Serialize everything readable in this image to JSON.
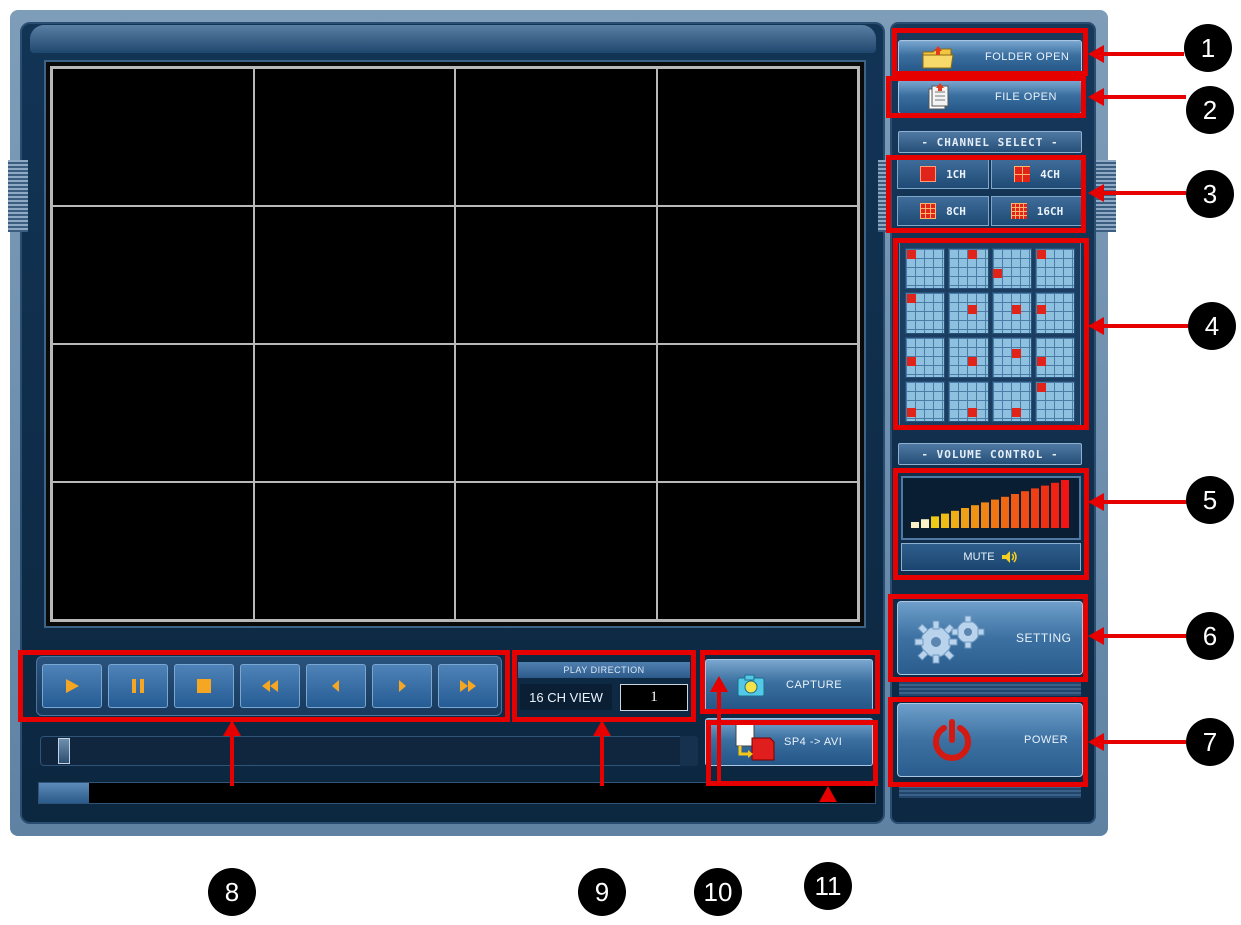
{
  "sidebar": {
    "folder_open_label": "FOLDER OPEN",
    "file_open_label": "FILE OPEN",
    "channel_select_title": "- CHANNEL SELECT -",
    "channels": [
      "1CH",
      "4CH",
      "8CH",
      "16CH"
    ],
    "volume_control_title": "- VOLUME CONTROL -",
    "mute_label": "MUTE",
    "setting_label": "SETTING",
    "power_label": "POWER"
  },
  "playback": {
    "play_direction_title": "PLAY DIRECTION",
    "view_label": "16 CH VIEW",
    "channel_value": "1",
    "capture_label": "CAPTURE",
    "convert_label": "SP4 -> AVI"
  },
  "video_grid": {
    "rows": 4,
    "columns": 4
  },
  "volume": {
    "bar_count": 16
  },
  "annotations": [
    "1",
    "2",
    "3",
    "4",
    "5",
    "6",
    "7",
    "8",
    "9",
    "10",
    "11"
  ],
  "colors": {
    "annotation": "#e60000",
    "panel": "#123455",
    "accent": "#3a6f9f",
    "split_marker": "#e0241a"
  }
}
